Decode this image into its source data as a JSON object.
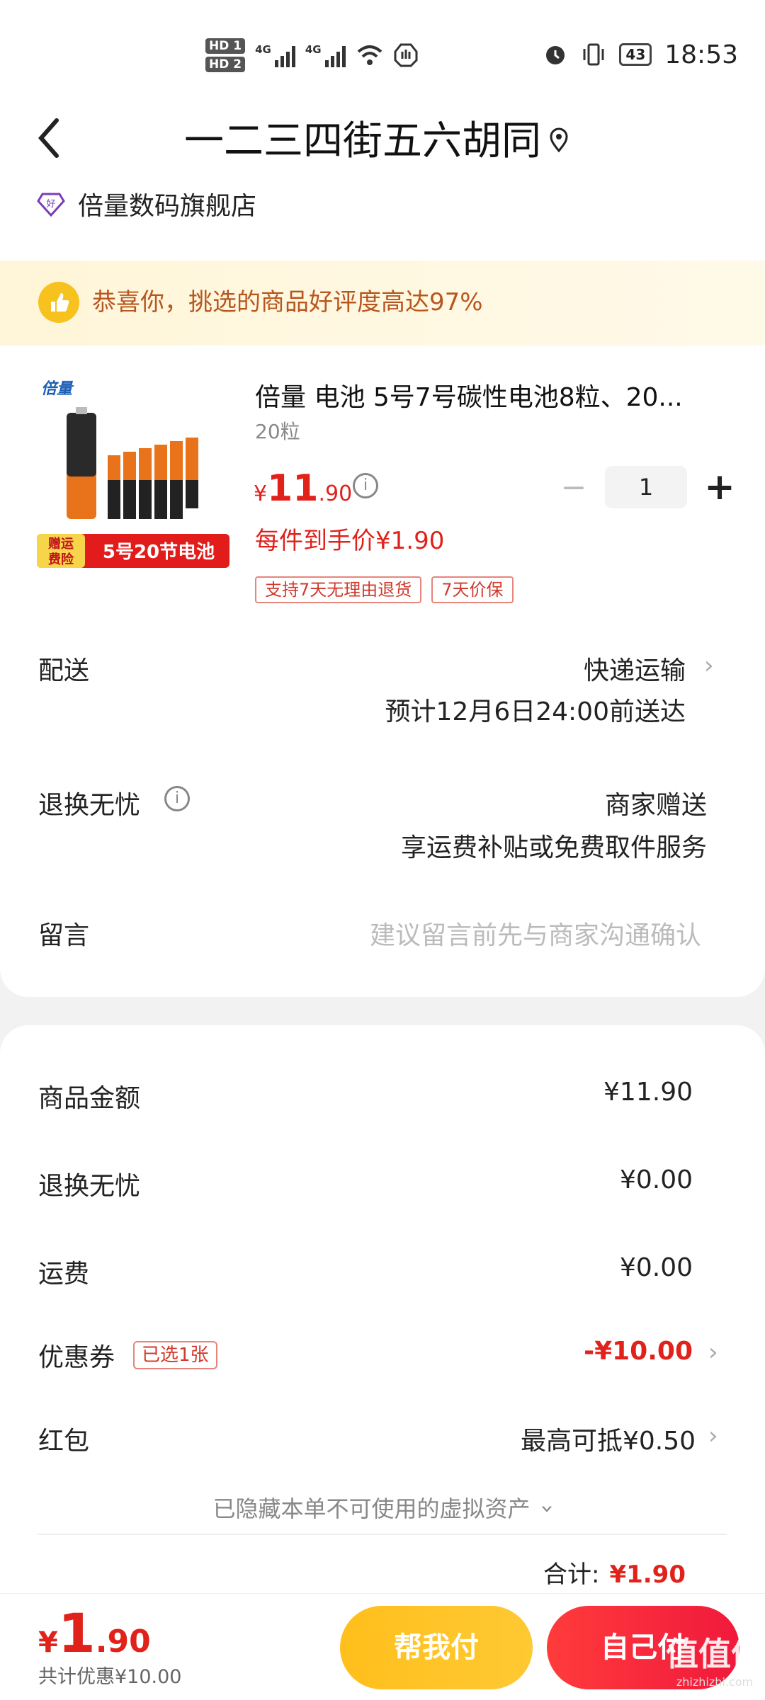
{
  "status_bar": {
    "hd1": "HD 1",
    "hd2": "HD 2",
    "net1": "4G",
    "net2": "4G",
    "battery": "43",
    "time": "18:53"
  },
  "header": {
    "address": "一二三四街五六胡同",
    "store_name": "倍量数码旗舰店"
  },
  "banner": {
    "text": "恭喜你，挑选的商品好评度高达97%"
  },
  "product": {
    "image_brand": "倍量",
    "image_badge": "赠运费险",
    "image_caption": "5号20节电池",
    "title": "倍量 电池 5号7号碳性电池8粒、20...",
    "spec": "20粒",
    "price_symbol": "¥",
    "price_int": "11",
    "price_dec": ".90",
    "quantity": "1",
    "unit_price_text": "每件到手价¥1.90",
    "tags": [
      "支持7天无理由退货",
      "7天价保"
    ]
  },
  "rows": {
    "delivery_label": "配送",
    "delivery_method": "快递运输",
    "delivery_eta": "预计12月6日24:00前送达",
    "return_label": "退换无忧",
    "return_value1": "商家赠送",
    "return_value2": "享运费补贴或免费取件服务",
    "note_label": "留言",
    "note_placeholder": "建议留言前先与商家沟通确认"
  },
  "summary": {
    "goods_label": "商品金额",
    "goods_value": "¥11.90",
    "return_label": "退换无忧",
    "return_value": "¥0.00",
    "shipping_label": "运费",
    "shipping_value": "¥0.00",
    "coupon_label": "优惠券",
    "coupon_tag": "已选1张",
    "coupon_value": "-¥10.00",
    "redpacket_label": "红包",
    "redpacket_value": "最高可抵¥0.50",
    "hidden_assets": "已隐藏本单不可使用的虚拟资产",
    "total_label": "合计:",
    "total_value": "¥1.90"
  },
  "bottom": {
    "price_symbol": "¥",
    "price_int": "1",
    "price_dec": ".90",
    "discount_text": "共计优惠¥10.00",
    "help_pay": "帮我付",
    "self_pay": "自己付",
    "watermark": "值值值",
    "watermark_sub": "zhizhizhi.com"
  },
  "colors": {
    "accent_red": "#e0221b",
    "banner_text": "#b8561f",
    "help_btn": "#ffbf1c",
    "self_btn": "#f0193c"
  }
}
